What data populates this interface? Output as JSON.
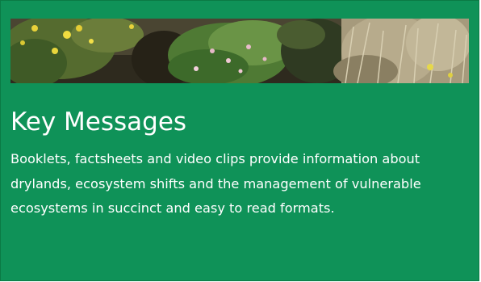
{
  "colors": {
    "card_background": "#0f9258",
    "text": "#ffffff"
  },
  "banner": {
    "image_icon": "shrubland-photo-icon"
  },
  "card": {
    "title": "Key Messages",
    "description": "Booklets, factsheets and video clips provide information about drylands, ecosystem shifts and the management of vulnerable ecosystems in succinct and easy to read formats."
  }
}
